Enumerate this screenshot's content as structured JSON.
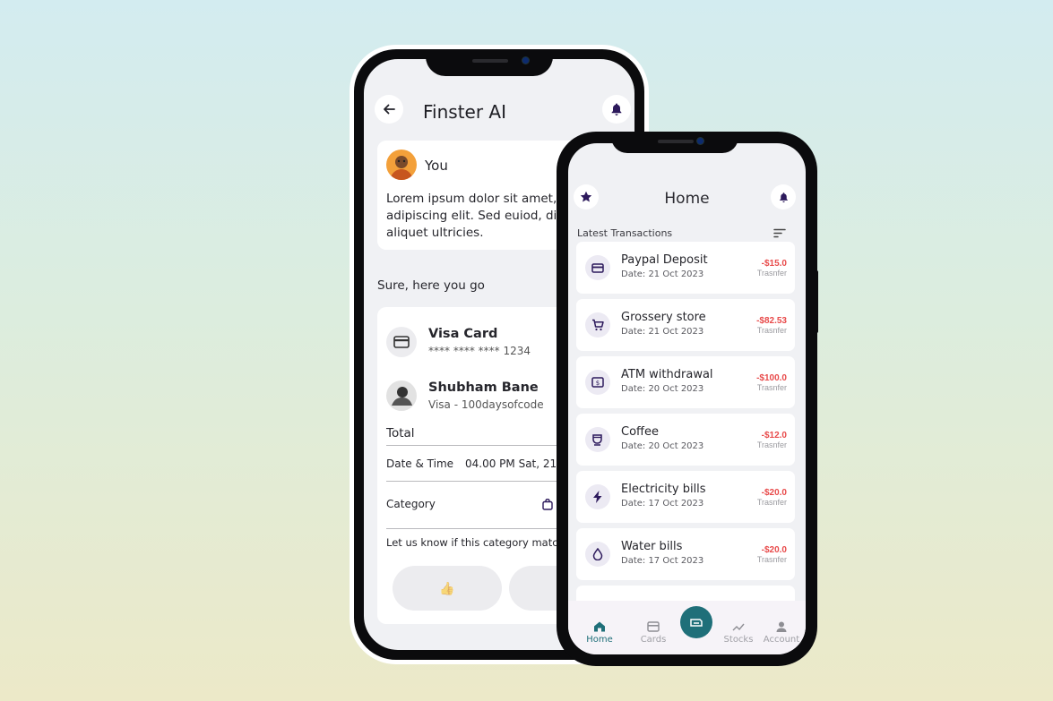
{
  "chat": {
    "title": "Finster AI",
    "user_name": "You",
    "message_lines": [
      "Lorem ipsum dolor sit amet, c",
      "adipiscing elit. Sed euiod, diar",
      "aliquet ultricies."
    ],
    "reply": "Sure, here you go",
    "card_title": "Visa Card",
    "card_number": "**** **** **** 1234",
    "payee_name": "Shubham Bane",
    "payee_sub": "Visa - 100daysofcode",
    "total_label": "Total",
    "datetime_label": "Date & Time",
    "datetime_value": "04.00 PM Sat, 21 O",
    "category_label": "Category",
    "feedback_prompt": "Let us know if this category match",
    "thumbs_up": "👍",
    "icons": {
      "back": "arrow-left-icon",
      "bell": "bell-icon",
      "card": "credit-card-icon",
      "category": "shopping-bag-icon"
    }
  },
  "home": {
    "title": "Home",
    "section_title": "Latest Transactions",
    "transactions": [
      {
        "name": "Paypal Deposit",
        "date": "Date: 21 Oct 2023",
        "amount": "-$15.0",
        "type": "Trasnfer",
        "icon": "credit-card-icon"
      },
      {
        "name": "Grossery store",
        "date": "Date: 21 Oct 2023",
        "amount": "-$82.53",
        "type": "Trasnfer",
        "icon": "cart-icon"
      },
      {
        "name": "ATM withdrawal",
        "date": "Date: 20 Oct 2023",
        "amount": "-$100.0",
        "type": "Trasnfer",
        "icon": "cash-icon"
      },
      {
        "name": "Coffee",
        "date": "Date: 20 Oct 2023",
        "amount": "-$12.0",
        "type": "Trasnfer",
        "icon": "coffee-cup-icon"
      },
      {
        "name": "Electricity bills",
        "date": "Date: 17 Oct 2023",
        "amount": "-$20.0",
        "type": "Trasnfer",
        "icon": "lightning-icon"
      },
      {
        "name": "Water bills",
        "date": "Date: 17 Oct 2023",
        "amount": "-$20.0",
        "type": "Trasnfer",
        "icon": "water-drop-icon"
      }
    ],
    "nav": {
      "home": "Home",
      "cards": "Cards",
      "stocks": "Stocks",
      "account": "Account"
    },
    "colors": {
      "accent": "#1f6f79",
      "negative": "#e84a4a",
      "icon": "#2d1a5c"
    }
  }
}
